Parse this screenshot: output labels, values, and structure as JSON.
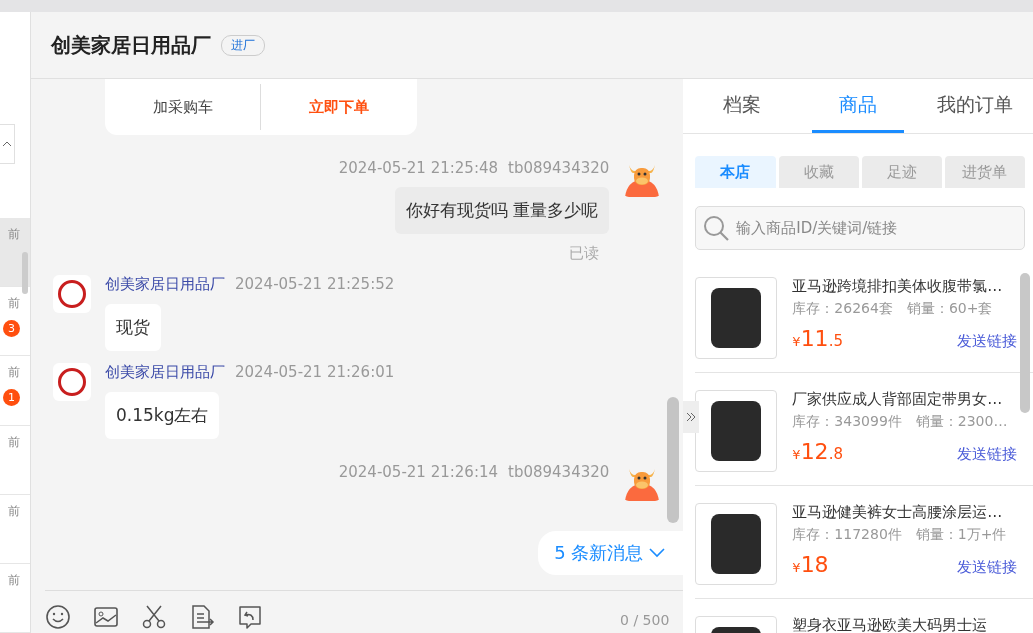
{
  "sidebar": {
    "items": [
      {
        "time": "前"
      },
      {
        "time": "前",
        "badge": "3"
      },
      {
        "time": "前",
        "badge": "1"
      },
      {
        "time": "前"
      },
      {
        "time": "前"
      },
      {
        "time": "前"
      }
    ]
  },
  "header": {
    "title": "创美家居日用品厂",
    "tag": "进厂"
  },
  "order_card": {
    "buttons": [
      {
        "label": "加采购车",
        "kind": "plain"
      },
      {
        "label": "立即下单",
        "kind": "primary"
      }
    ]
  },
  "messages": [
    {
      "kind": "sent",
      "time": "2024-05-21 21:25:48",
      "sender": "tb089434320",
      "text": "你好有现货吗   重量多少呢",
      "status": "已读"
    },
    {
      "kind": "received",
      "time": "2024-05-21 21:25:52",
      "sender": "创美家居日用品厂",
      "text": "现货"
    },
    {
      "kind": "received",
      "time": "2024-05-21 21:26:01",
      "sender": "创美家居日用品厂",
      "text": "0.15kg左右"
    },
    {
      "kind": "sent",
      "time": "2024-05-21 21:26:14",
      "sender": "tb089434320"
    }
  ],
  "new_messages": "5 条新消息",
  "composer": {
    "counter": "0 / 500"
  },
  "tabs": [
    {
      "label": "档案",
      "selected": false
    },
    {
      "label": "商品",
      "selected": true
    },
    {
      "label": "我的订单",
      "selected": false
    }
  ],
  "subtabs": [
    {
      "label": "本店",
      "selected": true
    },
    {
      "label": "收藏",
      "selected": false
    },
    {
      "label": "足迹",
      "selected": false
    },
    {
      "label": "进货单",
      "selected": false
    }
  ],
  "search": {
    "placeholder": "输入商品ID/关键词/链接"
  },
  "products": [
    {
      "title": "亚马逊跨境排扣美体收腹带氯…",
      "stock": "库存：26264套",
      "sales": "销量：60+套",
      "currency": "¥",
      "price_int": "11",
      "price_dec": ".5",
      "action": "发送链接"
    },
    {
      "title": "厂家供应成人背部固定带男女…",
      "stock": "库存：343099件",
      "sales": "销量：2300…",
      "currency": "¥",
      "price_int": "12",
      "price_dec": ".8",
      "action": "发送链接"
    },
    {
      "title": "亚马逊健美裤女士高腰涂层运…",
      "stock": "库存：117280件",
      "sales": "销量：1万+件",
      "currency": "¥",
      "price_int": "18",
      "action": "发送链接"
    },
    {
      "title": "塑身衣亚马逊欧美大码男士运"
    }
  ]
}
